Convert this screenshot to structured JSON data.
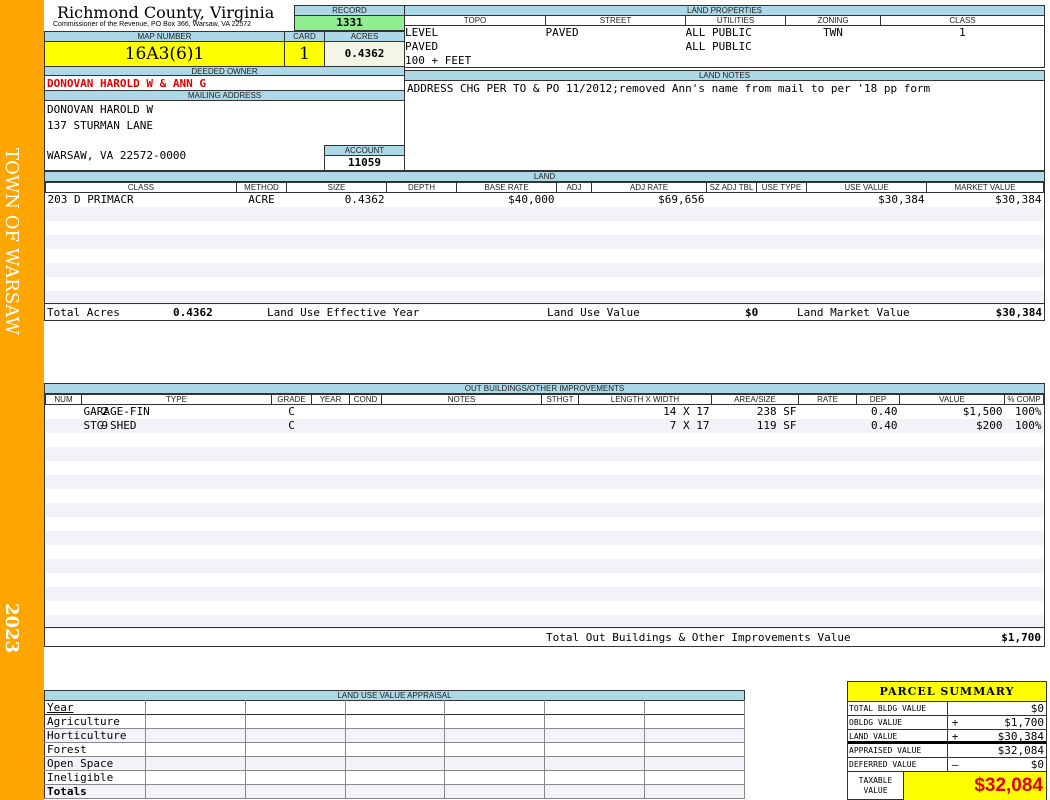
{
  "sidebar": {
    "town": "TOWN OF WARSAW",
    "year": "2023",
    "color": "#FFA500"
  },
  "header": {
    "title": "Richmond County, Virginia",
    "subtitle": "Commissioner of the Revenue, PO Box 366, Warsaw, VA 22572"
  },
  "record": {
    "label": "RECORD",
    "value": "1331"
  },
  "map": {
    "map_label": "MAP NUMBER",
    "map_value": "16A3(6)1",
    "card_label": "CARD",
    "card_value": "1",
    "acres_label": "ACRES",
    "acres_value": "0.4362"
  },
  "owner": {
    "label": "DEEDED OWNER",
    "value": "DONOVAN HAROLD W & ANN G"
  },
  "mailing": {
    "label": "MAILING ADDRESS",
    "lines": [
      "DONOVAN HAROLD W",
      "137 STURMAN LANE",
      "WARSAW, VA 22572-0000"
    ]
  },
  "account": {
    "label": "ACCOUNT",
    "value": "11059"
  },
  "land_properties": {
    "label": "LAND PROPERTIES",
    "columns": [
      "TOPO",
      "STREET",
      "UTILITIES",
      "ZONING",
      "CLASS"
    ],
    "rows": [
      [
        "LEVEL",
        "PAVED",
        "ALL PUBLIC",
        "TWN",
        "1"
      ],
      [
        "PAVED",
        "",
        "ALL PUBLIC",
        "",
        ""
      ],
      [
        "100 + FEET",
        "",
        "",
        "",
        ""
      ]
    ]
  },
  "land_notes": {
    "label": "LAND NOTES",
    "text": "ADDRESS CHG PER TO & PO 11/2012;removed Ann's  name from mail to per '18 pp form"
  },
  "land": {
    "label": "LAND",
    "columns": [
      "CLASS",
      "METHOD",
      "SIZE",
      "DEPTH",
      "BASE RATE",
      "ADJ",
      "ADJ RATE",
      "SZ ADJ TBL",
      "USE TYPE",
      "USE VALUE",
      "MARKET VALUE"
    ],
    "rows": [
      [
        "203 D PRIMACR",
        "ACRE",
        "0.4362",
        "",
        "$40,000",
        "",
        "$69,656",
        "",
        "",
        "$30,384",
        "$30,384"
      ]
    ],
    "totals": {
      "acres_label": "Total Acres",
      "acres": "0.4362",
      "effective_year_label": "Land Use Effective Year",
      "use_value_label": "Land Use Value",
      "use_value": "$0",
      "market_label": "Land Market Value",
      "market": "$30,384"
    }
  },
  "outbuildings": {
    "label": "OUT BUILDINGS/OTHER IMPROVEMENTS",
    "columns": [
      "NUM",
      "TYPE",
      "GRADE",
      "YEAR",
      "COND",
      "NOTES",
      "STHGT",
      "LENGTH X WIDTH",
      "AREA/SIZE",
      "RATE",
      "DEP",
      "VALUE",
      "% COMP"
    ],
    "rows": [
      [
        "2",
        "GARAGE-FIN",
        "C",
        "",
        "",
        "",
        "",
        "14 X 17",
        "238 SF",
        "",
        "0.40",
        "$1,500",
        "100%"
      ],
      [
        "9",
        "STG SHED",
        "C",
        "",
        "",
        "",
        "",
        "7 X 17",
        "119 SF",
        "",
        "0.40",
        "$200",
        "100%"
      ]
    ],
    "total_label": "Total Out Buildings & Other Improvements Value",
    "total": "$1,700"
  },
  "land_use_appraisal": {
    "label": "LAND USE VALUE APPRAISAL",
    "year_label": "Year",
    "rows": [
      "Agriculture",
      "Horticulture",
      "Forest",
      "Open Space",
      "Ineligible"
    ],
    "totals_label": "Totals"
  },
  "parcel_summary": {
    "title": "PARCEL SUMMARY",
    "rows": [
      {
        "label": "TOTAL BLDG VALUE",
        "sign": "",
        "value": "$0"
      },
      {
        "label": "OBLDG VALUE",
        "sign": "+",
        "value": "$1,700"
      },
      {
        "label": "LAND VALUE",
        "sign": "+",
        "value": "$30,384"
      },
      {
        "label": "APPRAISED VALUE",
        "sign": "",
        "value": "$32,084"
      },
      {
        "label": "DEFERRED VALUE",
        "sign": "–",
        "value": "$0"
      }
    ],
    "taxable_label": "TAXABLE VALUE",
    "taxable_value": "$32,084"
  }
}
